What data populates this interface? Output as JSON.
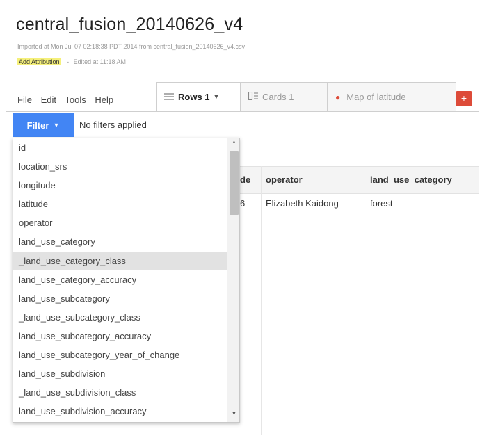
{
  "document": {
    "title": "central_fusion_20140626_v4",
    "imported_text": "Imported at Mon Jul 07 02:18:38 PDT 2014 from central_fusion_20140626_v4.csv",
    "add_attribution_label": "Add Attribution",
    "separator": "-",
    "edited_text": "Edited at 11:18 AM"
  },
  "menu": {
    "file": "File",
    "edit": "Edit",
    "tools": "Tools",
    "help": "Help"
  },
  "tabs": [
    {
      "label": "Rows 1",
      "icon": "rows-icon",
      "active": true
    },
    {
      "label": "Cards 1",
      "icon": "cards-icon",
      "active": false
    },
    {
      "label": "Map of latitude",
      "icon": "map-pin-icon",
      "active": false
    }
  ],
  "add_tab_label": "+",
  "filter": {
    "button_label": "Filter",
    "status": "No filters applied"
  },
  "dropdown": {
    "items": [
      "id",
      "location_srs",
      "longitude",
      "latitude",
      "operator",
      "land_use_category",
      "_land_use_category_class",
      "land_use_category_accuracy",
      "land_use_subcategory",
      "_land_use_subcategory_class",
      "land_use_subcategory_accuracy",
      "land_use_subcategory_year_of_change",
      "land_use_subdivision",
      "_land_use_subdivision_class",
      "land_use_subdivision_accuracy"
    ],
    "highlighted_item": "_land_use_category_class",
    "highlighted_index": 6
  },
  "table": {
    "headers": [
      "de",
      "operator",
      "land_use_category"
    ],
    "rows": [
      [
        "6",
        "Elizabeth Kaidong",
        "forest"
      ]
    ]
  },
  "colors": {
    "accent_blue": "#4285f4",
    "accent_red": "#dd4b39",
    "attribution_highlight": "#f5f07a"
  }
}
